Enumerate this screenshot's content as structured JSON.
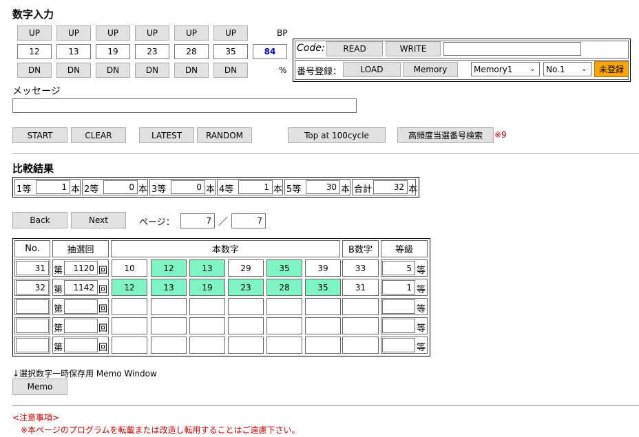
{
  "title": "数字入力",
  "number_input": {
    "up_label": "UP",
    "dn_label": "DN",
    "values": [
      "12",
      "13",
      "19",
      "23",
      "28",
      "35"
    ],
    "bp_label": "BP",
    "bp_value": "84",
    "percent_label": "%"
  },
  "code_panel": {
    "code_label": "Code:",
    "read_label": "READ",
    "write_label": "WRITE",
    "code_value": "",
    "register_label": "番号登録：",
    "load_label": "LOAD",
    "memory_label": "Memory",
    "memory_select": "Memory1",
    "no_select": "No.1",
    "status_badge": "未登録"
  },
  "message": {
    "label": "メッセージ",
    "value": ""
  },
  "actions": {
    "start": "START",
    "clear": "CLEAR",
    "latest": "LATEST",
    "random": "RANDOM",
    "top100": "Top at 100cycle",
    "high_freq": "高頻度当選番号検索",
    "note_mark": "※9"
  },
  "comparison": {
    "title": "比較結果",
    "items": [
      {
        "label": "1等",
        "value": "1",
        "unit": "本"
      },
      {
        "label": "2等",
        "value": "0",
        "unit": "本"
      },
      {
        "label": "3等",
        "value": "0",
        "unit": "本"
      },
      {
        "label": "4等",
        "value": "1",
        "unit": "本"
      },
      {
        "label": "5等",
        "value": "30",
        "unit": "本"
      },
      {
        "label": "合計",
        "value": "32",
        "unit": "本"
      }
    ]
  },
  "pager": {
    "back": "Back",
    "next": "Next",
    "page_label": "ページ：",
    "current": "7",
    "separator": "／",
    "total": "7"
  },
  "results_table": {
    "headers": {
      "no": "No.",
      "draw": "抽選回",
      "main": "本数字",
      "bonus": "B数字",
      "grade": "等級"
    },
    "draw_prefix": "第",
    "draw_suffix": "回",
    "grade_suffix": "等",
    "rows": [
      {
        "no": "31",
        "draw": "1120",
        "nums": [
          "10",
          "12",
          "13",
          "29",
          "35",
          "39"
        ],
        "hits": [
          false,
          true,
          true,
          false,
          true,
          false
        ],
        "bonus": "33",
        "grade": "5"
      },
      {
        "no": "32",
        "draw": "1142",
        "nums": [
          "12",
          "13",
          "19",
          "23",
          "28",
          "35"
        ],
        "hits": [
          true,
          true,
          true,
          true,
          true,
          true
        ],
        "bonus": "31",
        "grade": "1"
      },
      {
        "no": "",
        "draw": "",
        "nums": [
          "",
          "",
          "",
          "",
          "",
          ""
        ],
        "hits": [
          false,
          false,
          false,
          false,
          false,
          false
        ],
        "bonus": "",
        "grade": ""
      },
      {
        "no": "",
        "draw": "",
        "nums": [
          "",
          "",
          "",
          "",
          "",
          ""
        ],
        "hits": [
          false,
          false,
          false,
          false,
          false,
          false
        ],
        "bonus": "",
        "grade": ""
      },
      {
        "no": "",
        "draw": "",
        "nums": [
          "",
          "",
          "",
          "",
          "",
          ""
        ],
        "hits": [
          false,
          false,
          false,
          false,
          false,
          false
        ],
        "bonus": "",
        "grade": ""
      }
    ]
  },
  "memo": {
    "caption": "↓選択数字一時保存用 Memo Window",
    "button": "Memo"
  },
  "notice": {
    "title": "<注意事項>",
    "text": "※本ページのプログラムを転載または改造し転用することはご遠慮下さい。"
  },
  "colors": {
    "hit": "#7ff5c4",
    "badge": "#ffa500",
    "bp_value": "#0000cc",
    "notice": "#d00000"
  }
}
